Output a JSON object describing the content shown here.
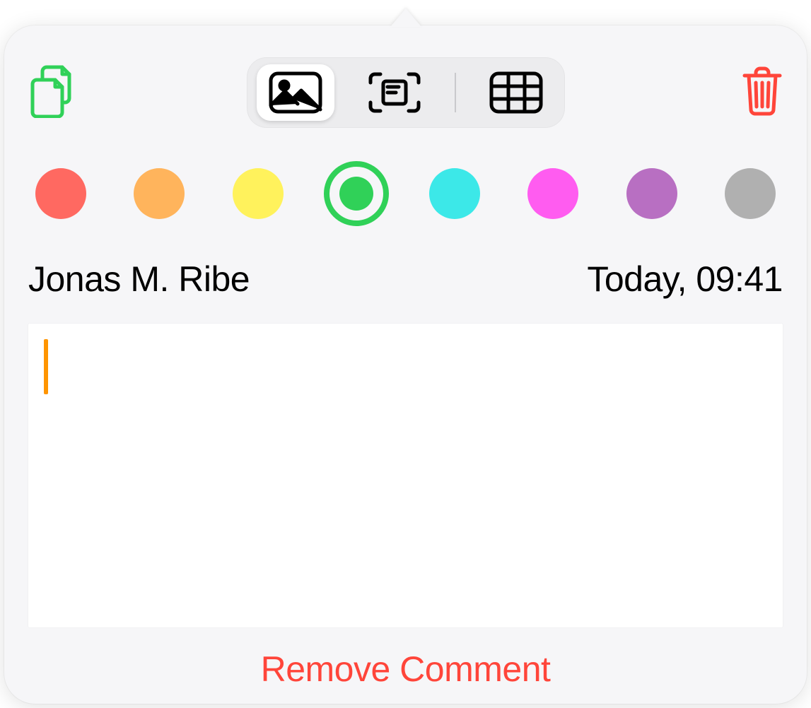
{
  "toolbar": {
    "copy_icon": "copy-documents",
    "trash_icon": "trash",
    "segments": {
      "image": {
        "icon": "image",
        "selected": true
      },
      "scan": {
        "icon": "scan-document",
        "selected": false
      },
      "table": {
        "icon": "table",
        "selected": false
      }
    }
  },
  "colors": [
    {
      "name": "red",
      "hex": "#ff6961",
      "selected": false
    },
    {
      "name": "orange",
      "hex": "#ffb45c",
      "selected": false
    },
    {
      "name": "yellow",
      "hex": "#fff25c",
      "selected": false
    },
    {
      "name": "green",
      "hex": "#30d158",
      "selected": true
    },
    {
      "name": "cyan",
      "hex": "#3ce8e8",
      "selected": false
    },
    {
      "name": "magenta",
      "hex": "#ff5cf0",
      "selected": false
    },
    {
      "name": "purple",
      "hex": "#b86fc2",
      "selected": false
    },
    {
      "name": "gray",
      "hex": "#b0b0b0",
      "selected": false
    }
  ],
  "meta": {
    "author": "Jonas M. Ribe",
    "timestamp": "Today, 09:41"
  },
  "comment": {
    "value": "",
    "cursor_color": "#ff9500"
  },
  "actions": {
    "remove_label": "Remove Comment"
  }
}
